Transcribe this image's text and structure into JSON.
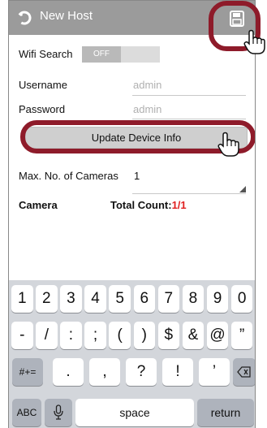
{
  "header": {
    "title": "New Host"
  },
  "wifi_search": {
    "label": "Wifi Search",
    "toggle": "OFF"
  },
  "username": {
    "label": "Username",
    "value": "admin"
  },
  "password": {
    "label": "Password",
    "value": "admin"
  },
  "update_button": "Update Device Info",
  "max_cameras": {
    "label": "Max. No. of Cameras",
    "value": "1"
  },
  "camera_header": {
    "label": "Camera",
    "total_label": "Total Count:",
    "total_value": "1/1"
  },
  "keyboard": {
    "row1": [
      "1",
      "2",
      "3",
      "4",
      "5",
      "6",
      "7",
      "8",
      "9",
      "0"
    ],
    "row2": [
      "-",
      "/",
      ":",
      ";",
      "(",
      ")",
      "$",
      "&",
      "@",
      "”"
    ],
    "row3": [
      "#+=",
      ".",
      ",",
      "?",
      "!",
      "’"
    ],
    "row4": {
      "abc": "ABC",
      "space": "space",
      "return": "return"
    }
  },
  "colors": {
    "highlight": "#8e1b2a",
    "accent_red": "#e02020",
    "titlebar": "#9b9b9b"
  }
}
